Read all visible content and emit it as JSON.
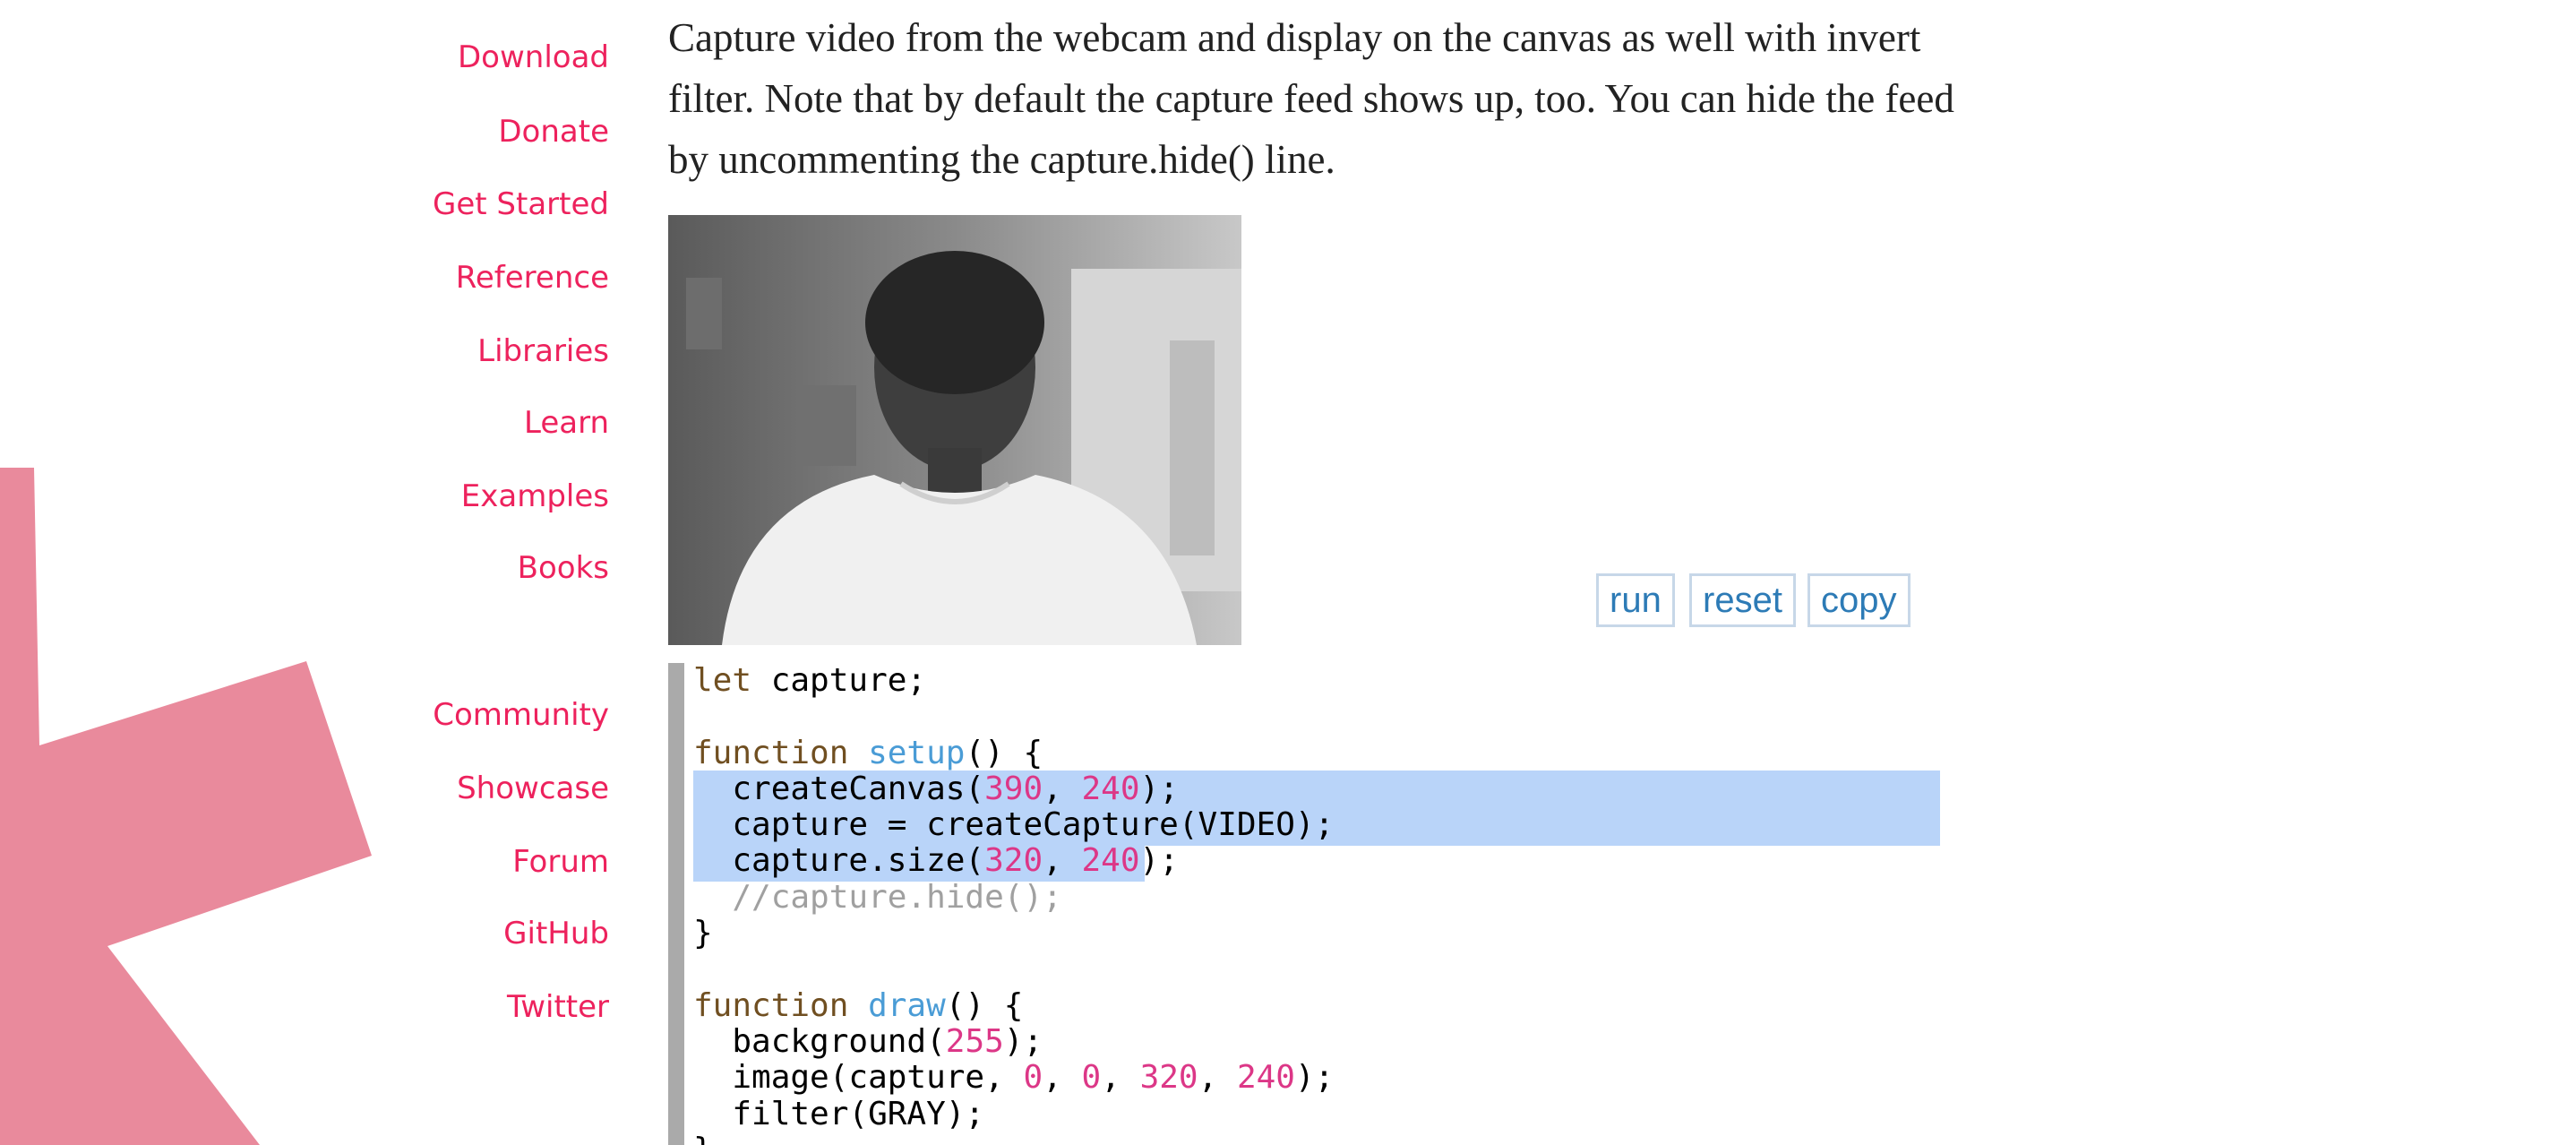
{
  "nav": {
    "primary": [
      "Download",
      "Donate",
      "Get Started",
      "Reference",
      "Libraries",
      "Learn",
      "Examples",
      "Books"
    ],
    "community": [
      "Community",
      "Showcase",
      "Forum",
      "GitHub",
      "Twitter"
    ]
  },
  "description": "Capture video from the webcam and display on the canvas as well with invert filter. Note that by default the capture feed shows up, too. You can hide the feed by uncommenting the capture.hide() line.",
  "sketch": {
    "canvas_image": "grayscale webcam capture of a person"
  },
  "buttons": {
    "run": "run",
    "reset": "reset",
    "copy": "copy"
  },
  "code": {
    "line1": {
      "kw": "let",
      "rest": " capture;"
    },
    "line3": {
      "kw": "function",
      "fn": "setup",
      "rest": "() {"
    },
    "line4": {
      "pre": "  createCanvas(",
      "n1": "390",
      "mid": ", ",
      "n2": "240",
      "post": ");"
    },
    "line5": {
      "text": "  capture = createCapture(VIDEO);"
    },
    "line6": {
      "pre": "  capture.size(",
      "n1": "320",
      "mid": ", ",
      "n2": "240",
      "post": ");"
    },
    "line7": {
      "comment": "  //capture.hide();"
    },
    "line8": {
      "text": "}"
    },
    "line10": {
      "kw": "function",
      "fn": "draw",
      "rest": "() {"
    },
    "line11": {
      "pre": "  background(",
      "n1": "255",
      "post": ");"
    },
    "line12": {
      "pre": "  image(capture, ",
      "n1": "0",
      "s1": ", ",
      "n2": "0",
      "s2": ", ",
      "n3": "320",
      "s3": ", ",
      "n4": "240",
      "post": ");"
    },
    "line13": {
      "text": "  filter(GRAY);"
    },
    "line14": {
      "text": "}"
    }
  },
  "colors": {
    "accent": "#ed225d",
    "asterisk": "#e98a9c",
    "button_text": "#2d7bb6",
    "selection": "#b9d4f9"
  }
}
